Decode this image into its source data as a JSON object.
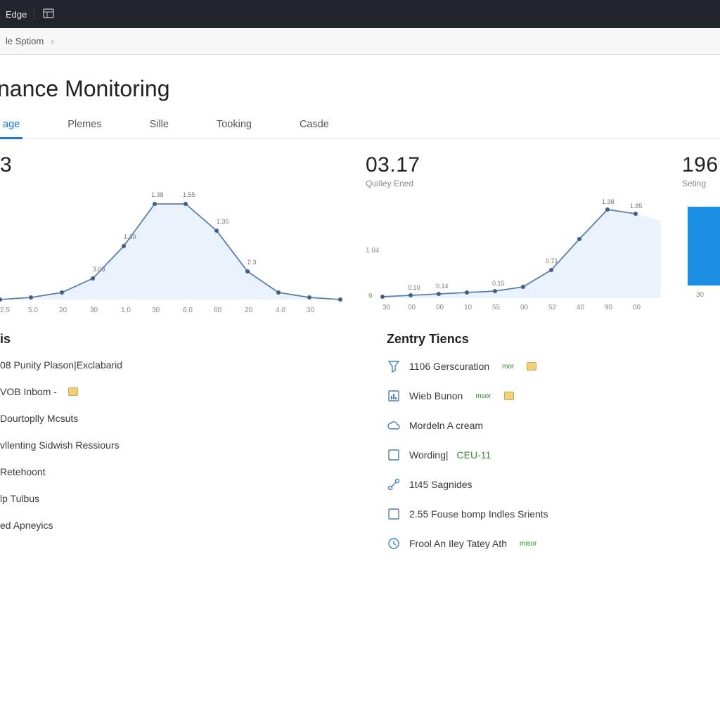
{
  "topbar": {
    "brand": "Edge"
  },
  "breadcrumb": {
    "item": "le Sptiom"
  },
  "page_title": "nance Monitoring",
  "tabs": [
    {
      "label": "age",
      "active": true
    },
    {
      "label": "Plemes",
      "active": false
    },
    {
      "label": "Sille",
      "active": false
    },
    {
      "label": "Tooking",
      "active": false
    },
    {
      "label": "Casde",
      "active": false
    }
  ],
  "stats": {
    "left_value": "3",
    "mid_value": "03.17",
    "mid_sub": "Quilley Ened",
    "right_value": "196",
    "right_sub": "Seting"
  },
  "left_list": {
    "title": "is",
    "items": [
      {
        "text": "08 Punity Plason|Exclabarid"
      },
      {
        "text": "VOB Inbom -",
        "badge": true
      },
      {
        "text": "Dourtoplly Mcsuts"
      },
      {
        "text": "vllenting Sidwish Ressiours"
      },
      {
        "text": "Retehoont"
      },
      {
        "text": "lp Tulbus"
      },
      {
        "text": "ed Apneyics"
      }
    ]
  },
  "right_list": {
    "title": "Zentry Tiencs",
    "items": [
      {
        "icon": "funnel",
        "text": "1106 Gerscuration",
        "tag": "mor",
        "badge": true
      },
      {
        "icon": "report",
        "text": "Wieb Bunon",
        "tag": "msor",
        "badge": true
      },
      {
        "icon": "cloud",
        "text": "Mordeln A cream"
      },
      {
        "icon": "square",
        "text": "Wording|",
        "suffix": "CEU-11"
      },
      {
        "icon": "route",
        "text": "1t45 Sagnides"
      },
      {
        "icon": "square",
        "text": "2.55 Fouse bomp Indles Srients"
      },
      {
        "icon": "clock",
        "text": "Frool An Iley Tatey Ath",
        "tag": "misor"
      }
    ]
  },
  "chart_data": [
    {
      "type": "area",
      "title": "",
      "categories": [
        "2.5",
        "5.0",
        "20",
        "30",
        "1.0",
        "30",
        "6.0",
        "60",
        "20",
        "4.0",
        "30"
      ],
      "values": [
        0.2,
        0.25,
        0.35,
        0.6,
        1.1,
        1.55,
        1.45,
        1.0,
        0.45,
        0.25,
        0.2
      ],
      "point_labels": [
        "",
        "",
        "3.03",
        "1.30",
        "1.38",
        "1.55",
        "",
        "1.35",
        "2.3",
        "",
        ""
      ],
      "ylim": [
        0,
        1.7
      ]
    },
    {
      "type": "area",
      "title": "Quilley Ened",
      "y_side_labels": [
        "1.04",
        "9"
      ],
      "categories": [
        "30",
        "00",
        "00",
        "10",
        "55",
        "00",
        "52",
        "40",
        "90",
        "00"
      ],
      "values": [
        0.08,
        0.1,
        0.12,
        0.14,
        0.16,
        0.22,
        0.45,
        0.9,
        1.3,
        1.25
      ],
      "point_labels": [
        "",
        "0.10",
        "0.14",
        "",
        "0.15",
        "0.71",
        "",
        "1.38",
        "1.85",
        ""
      ],
      "ylim": [
        0,
        1.4
      ]
    },
    {
      "type": "bar",
      "categories": [
        "30"
      ],
      "values": [
        1
      ],
      "ylim": [
        0,
        1
      ]
    }
  ]
}
